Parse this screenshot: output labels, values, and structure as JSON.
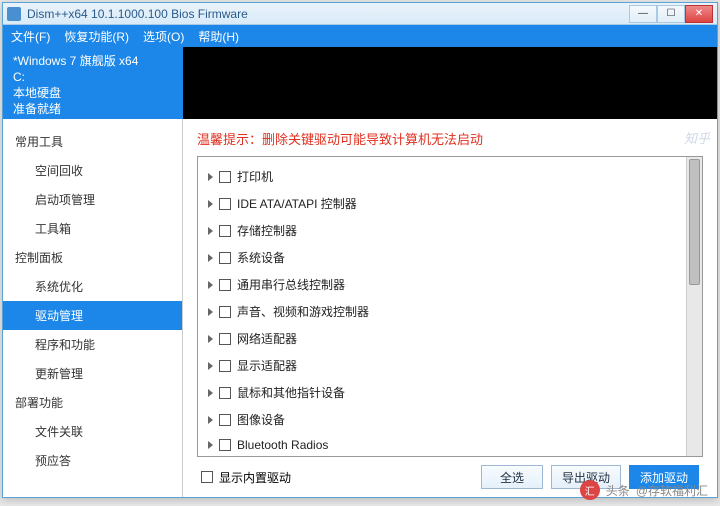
{
  "window": {
    "title": "Dism++x64 10.1.1000.100 Bios Firmware"
  },
  "menu": {
    "file": "文件(F)",
    "recover": "恢复功能(R)",
    "options": "选项(O)",
    "help": "帮助(H)"
  },
  "info": {
    "line1": "*Windows 7 旗舰版 x64",
    "line2": "C:",
    "line3": "本地硬盘",
    "line4": "准备就绪"
  },
  "sidebar": {
    "g1": {
      "title": "常用工具",
      "i0": "空间回收",
      "i1": "启动项管理",
      "i2": "工具箱"
    },
    "g2": {
      "title": "控制面板",
      "i0": "系统优化",
      "i1": "驱动管理",
      "i2": "程序和功能",
      "i3": "更新管理"
    },
    "g3": {
      "title": "部署功能",
      "i0": "文件关联",
      "i1": "预应答"
    }
  },
  "main": {
    "warning": "温馨提示：删除关键驱动可能导致计算机无法启动",
    "items": {
      "i0": "打印机",
      "i1": "IDE ATA/ATAPI 控制器",
      "i2": "存储控制器",
      "i3": "系统设备",
      "i4": "通用串行总线控制器",
      "i5": "声音、视频和游戏控制器",
      "i6": "网络适配器",
      "i7": "显示适配器",
      "i8": "鼠标和其他指针设备",
      "i9": "图像设备",
      "i10": "Bluetooth Radios"
    },
    "show_builtin": "显示内置驱动",
    "btn_all": "全选",
    "btn_export": "导出驱动",
    "btn_add": "添加驱动"
  },
  "watermark": {
    "prefix": "头条",
    "author": "@存软福利汇"
  },
  "zhihu": "知乎"
}
